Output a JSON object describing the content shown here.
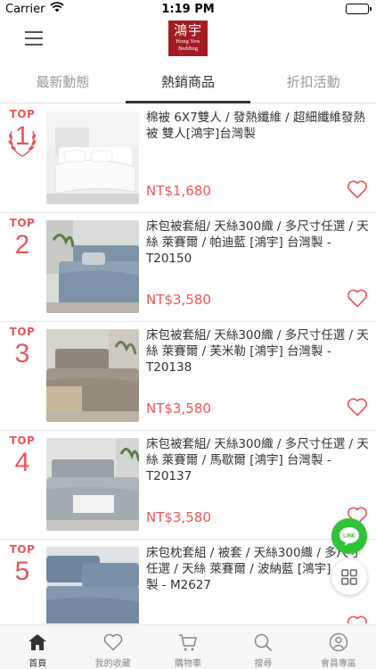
{
  "status_bar": {
    "carrier": "Carrier",
    "time": "1:19 PM"
  },
  "header": {
    "logo_cjk": "鴻宇",
    "logo_en_line1": "Hong Yew",
    "logo_en_line2": "Bedding"
  },
  "tabs": [
    {
      "label": "最新動態"
    },
    {
      "label": "熱銷商品"
    },
    {
      "label": "折扣活動"
    }
  ],
  "products": [
    {
      "rank_label": "TOP",
      "rank": "1",
      "title": "棉被 6X7雙人 / 發熱纖維 / 超細纖維發熱被 雙人[鴻宇]台灣製",
      "price": "NT$1,680"
    },
    {
      "rank_label": "TOP",
      "rank": "2",
      "title": "床包被套組/ 天絲300織 / 多尺寸任選 / 天絲 萊賽爾 / 帕迪藍 [鴻宇] 台灣製 - T20150",
      "price": "NT$3,580"
    },
    {
      "rank_label": "TOP",
      "rank": "3",
      "title": "床包被套組/ 天絲300織 / 多尺寸任選 / 天絲 萊賽爾 / 芙米勒 [鴻宇] 台灣製 - T20138",
      "price": "NT$3,580"
    },
    {
      "rank_label": "TOP",
      "rank": "4",
      "title": "床包被套組/ 天絲300織 / 多尺寸任選 / 天絲 萊賽爾 / 馬歇爾 [鴻宇] 台灣製 - T20137",
      "price": "NT$3,580"
    },
    {
      "rank_label": "TOP",
      "rank": "5",
      "title": "床包枕套組 / 被套 / 天絲300織 / 多尺寸任選 / 天絲 萊賽爾 / 波納藍 [鴻宇] 台灣製 - M2627",
      "price": ""
    }
  ],
  "floating": {
    "line_label": "LINE"
  },
  "bottom_nav": [
    {
      "label": "首頁"
    },
    {
      "label": "我的收藏"
    },
    {
      "label": "購物車"
    },
    {
      "label": "搜尋"
    },
    {
      "label": "會員專區"
    }
  ],
  "colors": {
    "accent": "#e8575a",
    "brand": "#a31b23",
    "line_green": "#2fc337"
  }
}
